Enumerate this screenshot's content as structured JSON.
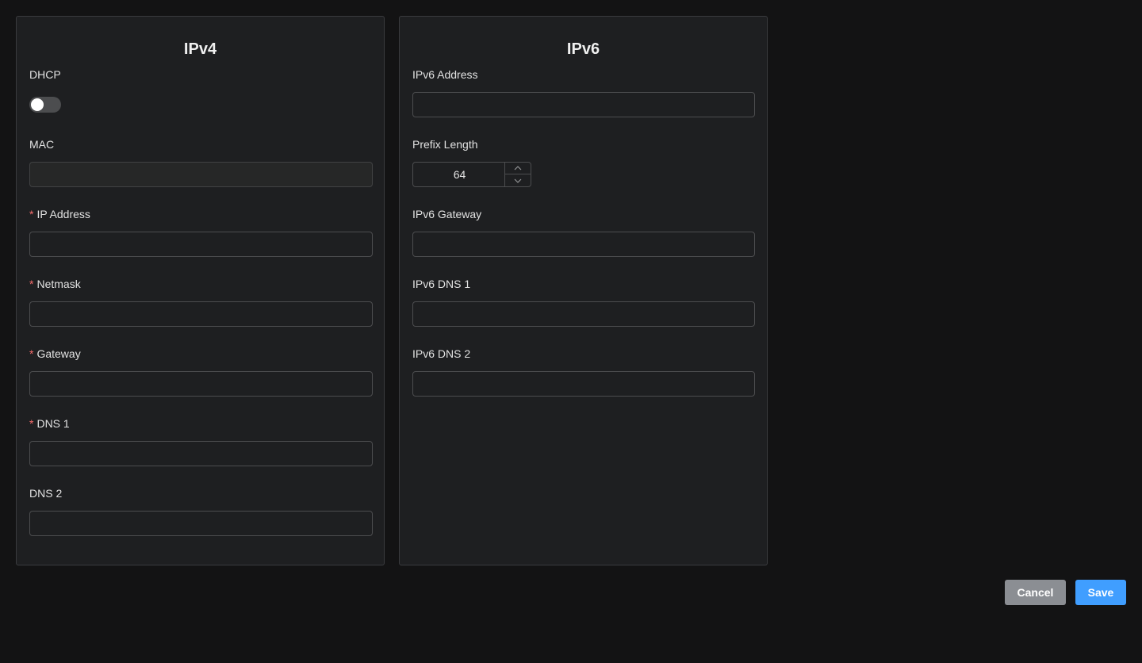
{
  "ipv4": {
    "title": "IPv4",
    "dhcp_label": "DHCP",
    "dhcp_enabled": false,
    "mac_label": "MAC",
    "mac_value": "",
    "ip_label": "IP Address",
    "ip_value": "",
    "netmask_label": "Netmask",
    "netmask_value": "",
    "gateway_label": "Gateway",
    "gateway_value": "",
    "dns1_label": "DNS 1",
    "dns1_value": "",
    "dns2_label": "DNS 2",
    "dns2_value": "",
    "required_mark": "*"
  },
  "ipv6": {
    "title": "IPv6",
    "address_label": "IPv6 Address",
    "address_value": "",
    "prefix_label": "Prefix Length",
    "prefix_value": "64",
    "gateway_label": "IPv6 Gateway",
    "gateway_value": "",
    "dns1_label": "IPv6 DNS 1",
    "dns1_value": "",
    "dns2_label": "IPv6 DNS 2",
    "dns2_value": ""
  },
  "actions": {
    "cancel_label": "Cancel",
    "save_label": "Save"
  },
  "colors": {
    "background": "#131314",
    "panel": "#1e1f21",
    "required": "#f56c6c",
    "save_button": "#409eff",
    "cancel_button": "#8b8e93"
  }
}
